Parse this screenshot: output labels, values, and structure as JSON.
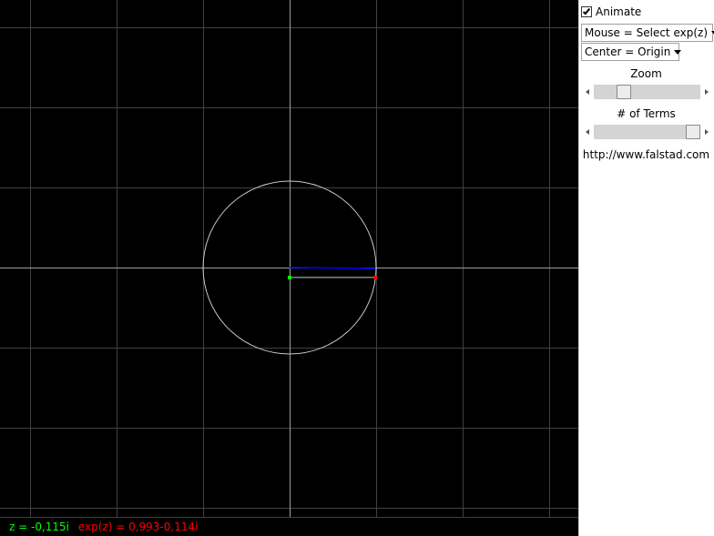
{
  "panel": {
    "animate_label": "Animate",
    "animate_checked": true,
    "mouse_dropdown": "Mouse = Select exp(z)",
    "center_dropdown": "Center = Origin",
    "zoom_label": "Zoom",
    "zoom_value": 0.25,
    "terms_label": "# of Terms",
    "terms_value": 1.0,
    "url": "http://www.falstad.com"
  },
  "readout": {
    "z_text": "z = -0,115i",
    "exp_text": "exp(z) = 0,993-0,114i"
  },
  "plot": {
    "z": {
      "re": 0,
      "im": -0.115
    },
    "exp_z": {
      "re": 0.993,
      "im": -0.114
    },
    "unit_circle_radius": 1,
    "colors": {
      "background": "#000000",
      "grid": "#404040",
      "axis": "#a0a0a0",
      "circle": "#c8c8c8",
      "vector": "#0000ff",
      "z_point": "#00ff00",
      "exp_point": "#ff0000"
    }
  }
}
